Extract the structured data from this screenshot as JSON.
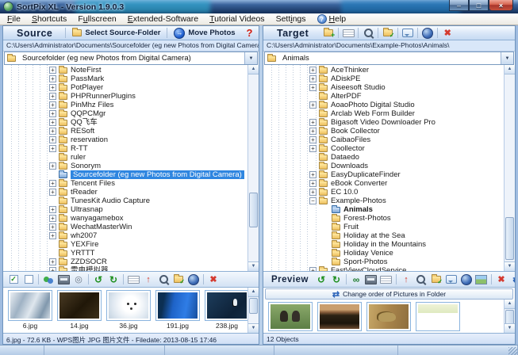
{
  "colors": {
    "selection_blue": "#2f86e0",
    "delete_red": "#d43a2f",
    "header_blue": "#c6daf2",
    "title_bar": "#16355f"
  },
  "window": {
    "title": "SortPix XL - Version 1.9.0.3",
    "controls": [
      {
        "name": "minimize",
        "glyph": "–"
      },
      {
        "name": "maximize",
        "glyph": "□"
      },
      {
        "name": "close",
        "glyph": "×"
      }
    ]
  },
  "menu": {
    "items": [
      {
        "label": "File",
        "key": "F"
      },
      {
        "label": "Shortcuts",
        "key": "S"
      },
      {
        "label": "Fullscreen",
        "key": "u"
      },
      {
        "label": "Extended-Software",
        "key": "E"
      },
      {
        "label": "Tutorial Videos",
        "key": "T"
      },
      {
        "label": "Settings",
        "key": "i"
      },
      {
        "label": "Help",
        "key": "H",
        "icon": "help-icon"
      }
    ]
  },
  "source": {
    "title": "Source",
    "select_folder_button": "Select Source-Folder",
    "move_photos_button": "Move Photos",
    "help_badge": "?",
    "path": "C:\\Users\\Administrator\\Documents\\Sourcefolder (eg new Photos from Digital Camera)\\",
    "folder_select": {
      "value": "Sourcefolder (eg new Photos from Digital Camera)"
    },
    "tree": {
      "items": [
        {
          "label": "NoteFirst",
          "expander": "plus"
        },
        {
          "label": "PassMark",
          "expander": "plus"
        },
        {
          "label": "PotPlayer",
          "expander": "plus"
        },
        {
          "label": "PHPRunnerPlugins",
          "expander": "plus"
        },
        {
          "label": "PinMhz Files",
          "expander": "plus"
        },
        {
          "label": "QQPCMgr",
          "expander": "plus"
        },
        {
          "label": "QQ飞车",
          "expander": "plus"
        },
        {
          "label": "RESoft",
          "expander": "plus"
        },
        {
          "label": "reservation",
          "expander": "plus"
        },
        {
          "label": "R-TT",
          "expander": "plus"
        },
        {
          "label": "ruler",
          "expander": "none"
        },
        {
          "label": "Sonorym",
          "expander": "plus"
        },
        {
          "label": "Sourcefolder (eg new Photos from Digital Camera)",
          "expander": "none",
          "selected": true,
          "selected_folder": true
        },
        {
          "label": "Tencent Files",
          "expander": "plus"
        },
        {
          "label": "tReader",
          "expander": "plus"
        },
        {
          "label": "TunesKit Audio Capture",
          "expander": "none"
        },
        {
          "label": "Ultrasnap",
          "expander": "plus"
        },
        {
          "label": "wanyagamebox",
          "expander": "plus"
        },
        {
          "label": "WechatMasterWin",
          "expander": "plus"
        },
        {
          "label": "wh2007",
          "expander": "plus"
        },
        {
          "label": "YEXFire",
          "expander": "none"
        },
        {
          "label": "YRTTT",
          "expander": "none"
        },
        {
          "label": "ZZDSOCR",
          "expander": "plus"
        },
        {
          "label": "雷电模拟器",
          "expander": "plus"
        }
      ]
    },
    "toolbar": {
      "icons": [
        "checkbox-checked-icon",
        "checkbox-empty-icon",
        "sep",
        "tools-icon",
        "slideshow-icon",
        "audio-icon",
        "sep",
        "rotate-left-icon",
        "rotate-right-icon",
        "sep",
        "rename-icon",
        "upload-icon",
        "search-icon",
        "apply-folder-icon",
        "undo-icon",
        "sep",
        "delete-icon"
      ]
    },
    "thumbnails": {
      "items": [
        {
          "filename": "6.jpg",
          "scene": "snow-birds"
        },
        {
          "filename": "14.jpg",
          "scene": "bird-flock"
        },
        {
          "filename": "36.jpg",
          "scene": "seal"
        },
        {
          "filename": "191.jpg",
          "scene": "parrot"
        },
        {
          "filename": "238.jpg",
          "scene": "penguin"
        }
      ]
    },
    "status": "6.jpg - 72.6 KB - WPS图片 JPG 图片文件 - Filedate: 2013-08-15 17:46"
  },
  "target": {
    "title": "Target",
    "toolbar": {
      "icons": [
        "new-folder-icon",
        "sep",
        "rename-icon",
        "sep",
        "search-icon",
        "sep",
        "apply-folder-icon",
        "sep",
        "feedback-icon",
        "sep",
        "undo-icon",
        "sep",
        "delete-icon"
      ]
    },
    "path": "C:\\Users\\Administrator\\Documents\\Example-Photos\\Animals\\",
    "folder_select": {
      "value": "Animals"
    },
    "tree": {
      "items": [
        {
          "label": "AceThinker",
          "expander": "plus"
        },
        {
          "label": "ADiskPE",
          "expander": "plus"
        },
        {
          "label": "Aiseesoft Studio",
          "expander": "plus"
        },
        {
          "label": "AlterPDF",
          "expander": "none"
        },
        {
          "label": "AoaoPhoto Digital Studio",
          "expander": "plus"
        },
        {
          "label": "Arclab Web Form Builder",
          "expander": "none"
        },
        {
          "label": "Bigasoft Video Downloader Pro",
          "expander": "plus"
        },
        {
          "label": "Book Collector",
          "expander": "plus"
        },
        {
          "label": "CaibaoFiles",
          "expander": "plus"
        },
        {
          "label": "Coollector",
          "expander": "plus"
        },
        {
          "label": "Dataedo",
          "expander": "none"
        },
        {
          "label": "Downloads",
          "expander": "none"
        },
        {
          "label": "EasyDuplicateFinder",
          "expander": "plus"
        },
        {
          "label": "eBook Converter",
          "expander": "plus"
        },
        {
          "label": "EC 10.0",
          "expander": "plus"
        },
        {
          "label": "Example-Photos",
          "expander": "minus"
        },
        {
          "label": "Animals",
          "expander": "none",
          "child": true,
          "selected_folder": true
        },
        {
          "label": "Forest-Photos",
          "expander": "none",
          "child": true
        },
        {
          "label": "Fruit",
          "expander": "none",
          "child": true
        },
        {
          "label": "Holiday at the Sea",
          "expander": "none",
          "child": true
        },
        {
          "label": "Holiday in the Mountains",
          "expander": "none",
          "child": true
        },
        {
          "label": "Holiday Venice",
          "expander": "none",
          "child": true
        },
        {
          "label": "Sport-Photos",
          "expander": "none",
          "child": true
        },
        {
          "label": "FastViewCloudService",
          "expander": "plus"
        }
      ]
    },
    "preview": {
      "title": "Preview",
      "toolbar": {
        "icons": [
          "rotate-left-icon",
          "rotate-right-icon",
          "sep",
          "binoculars-icon",
          "slideshow-icon",
          "rename-icon",
          "sep",
          "upload-icon",
          "search-icon",
          "apply-folder-icon",
          "feedback-icon",
          "undo-icon",
          "picture-icon",
          "sep",
          "delete-icon",
          "change-order-icon"
        ]
      },
      "change_order_button": "Change order of Pictures in Folder",
      "thumbnails": {
        "items": [
          {
            "scene": "vultures"
          },
          {
            "scene": "tree-sunset"
          },
          {
            "scene": "cheetah"
          },
          {
            "scene": "savanna",
            "partial": true
          }
        ]
      },
      "status": "12 Objects"
    }
  }
}
